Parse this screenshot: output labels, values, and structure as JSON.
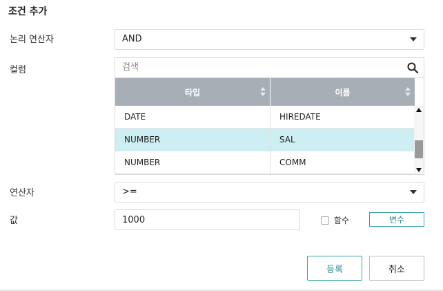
{
  "dialog": {
    "title": "조건 추가"
  },
  "logical_operator": {
    "label": "논리 연산자",
    "selected": "AND"
  },
  "column": {
    "label": "컬럼",
    "search_placeholder": "검색",
    "headers": [
      "타입",
      "이름"
    ],
    "rows": [
      {
        "type": "DATE",
        "name": "HIREDATE",
        "selected": false
      },
      {
        "type": "NUMBER",
        "name": "SAL",
        "selected": true
      },
      {
        "type": "NUMBER",
        "name": "COMM",
        "selected": false
      }
    ]
  },
  "operator": {
    "label": "연산자",
    "selected": ">="
  },
  "value": {
    "label": "값",
    "input_value": "1000",
    "function_checkbox_label": "함수",
    "function_checked": false,
    "variable_button": "변수"
  },
  "buttons": {
    "register": "등록",
    "cancel": "취소"
  },
  "colors": {
    "accent": "#35a0a8",
    "header_bg": "#a7aeb6",
    "selected_row": "#cdeef2"
  }
}
